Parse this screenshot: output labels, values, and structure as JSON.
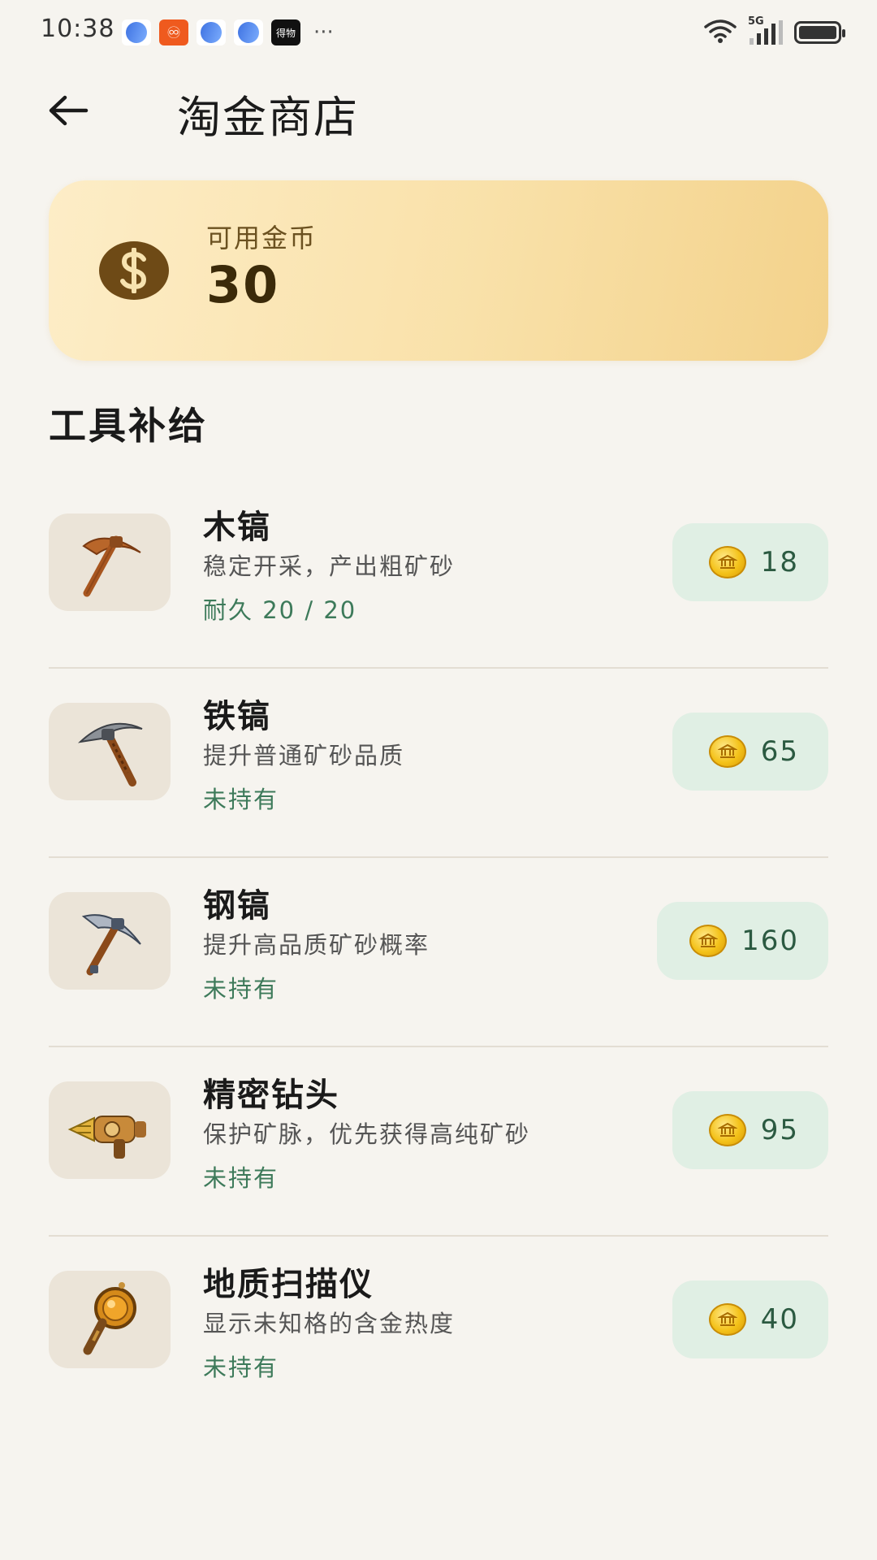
{
  "status_bar": {
    "time": "10:38",
    "network": "5G",
    "more": "···",
    "notif_dark_label": "得物"
  },
  "header": {
    "title": "淘金商店"
  },
  "coins": {
    "label": "可用金币",
    "amount": "30"
  },
  "section": {
    "title": "工具补给"
  },
  "items": [
    {
      "name": "木镐",
      "description": "稳定开采，产出粗矿砂",
      "status": "耐久 20 / 20",
      "price": "18",
      "icon": "wooden-pickaxe-icon"
    },
    {
      "name": "铁镐",
      "description": "提升普通矿砂品质",
      "status": "未持有",
      "price": "65",
      "icon": "iron-pickaxe-icon"
    },
    {
      "name": "钢镐",
      "description": "提升高品质矿砂概率",
      "status": "未持有",
      "price": "160",
      "icon": "steel-pickaxe-icon"
    },
    {
      "name": "精密钻头",
      "description": "保护矿脉，优先获得高纯矿砂",
      "status": "未持有",
      "price": "95",
      "icon": "precision-drill-icon"
    },
    {
      "name": "地质扫描仪",
      "description": "显示未知格的含金热度",
      "status": "未持有",
      "price": "40",
      "icon": "geo-scanner-icon"
    }
  ],
  "colors": {
    "background": "#f6f4ef",
    "card_gold_start": "#fdedc7",
    "card_gold_end": "#f3d28b",
    "price_bg": "#e0efe4",
    "status_green": "#3d7a5a"
  }
}
